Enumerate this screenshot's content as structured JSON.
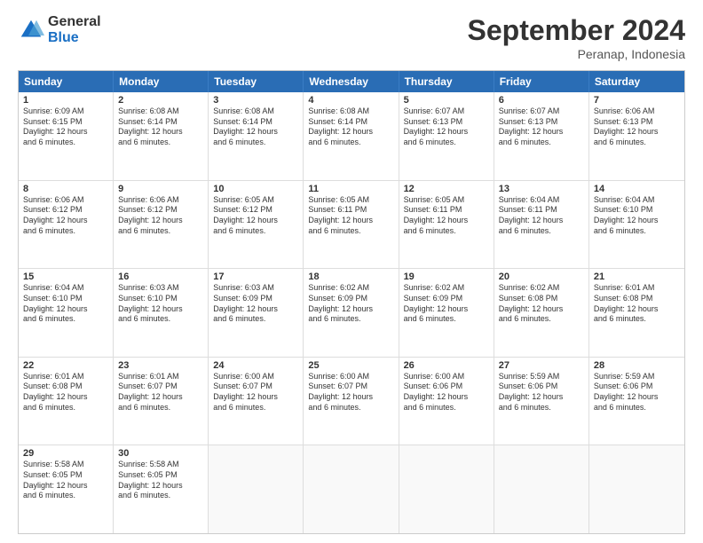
{
  "header": {
    "logo_general": "General",
    "logo_blue": "Blue",
    "title": "September 2024",
    "location": "Peranap, Indonesia"
  },
  "days": [
    "Sunday",
    "Monday",
    "Tuesday",
    "Wednesday",
    "Thursday",
    "Friday",
    "Saturday"
  ],
  "weeks": [
    [
      {
        "day": "1",
        "sunrise": "6:09 AM",
        "sunset": "6:15 PM",
        "daylight": "12 hours and 6 minutes."
      },
      {
        "day": "2",
        "sunrise": "6:08 AM",
        "sunset": "6:14 PM",
        "daylight": "12 hours and 6 minutes."
      },
      {
        "day": "3",
        "sunrise": "6:08 AM",
        "sunset": "6:14 PM",
        "daylight": "12 hours and 6 minutes."
      },
      {
        "day": "4",
        "sunrise": "6:08 AM",
        "sunset": "6:14 PM",
        "daylight": "12 hours and 6 minutes."
      },
      {
        "day": "5",
        "sunrise": "6:07 AM",
        "sunset": "6:13 PM",
        "daylight": "12 hours and 6 minutes."
      },
      {
        "day": "6",
        "sunrise": "6:07 AM",
        "sunset": "6:13 PM",
        "daylight": "12 hours and 6 minutes."
      },
      {
        "day": "7",
        "sunrise": "6:06 AM",
        "sunset": "6:13 PM",
        "daylight": "12 hours and 6 minutes."
      }
    ],
    [
      {
        "day": "8",
        "sunrise": "6:06 AM",
        "sunset": "6:12 PM",
        "daylight": "12 hours and 6 minutes."
      },
      {
        "day": "9",
        "sunrise": "6:06 AM",
        "sunset": "6:12 PM",
        "daylight": "12 hours and 6 minutes."
      },
      {
        "day": "10",
        "sunrise": "6:05 AM",
        "sunset": "6:12 PM",
        "daylight": "12 hours and 6 minutes."
      },
      {
        "day": "11",
        "sunrise": "6:05 AM",
        "sunset": "6:11 PM",
        "daylight": "12 hours and 6 minutes."
      },
      {
        "day": "12",
        "sunrise": "6:05 AM",
        "sunset": "6:11 PM",
        "daylight": "12 hours and 6 minutes."
      },
      {
        "day": "13",
        "sunrise": "6:04 AM",
        "sunset": "6:11 PM",
        "daylight": "12 hours and 6 minutes."
      },
      {
        "day": "14",
        "sunrise": "6:04 AM",
        "sunset": "6:10 PM",
        "daylight": "12 hours and 6 minutes."
      }
    ],
    [
      {
        "day": "15",
        "sunrise": "6:04 AM",
        "sunset": "6:10 PM",
        "daylight": "12 hours and 6 minutes."
      },
      {
        "day": "16",
        "sunrise": "6:03 AM",
        "sunset": "6:10 PM",
        "daylight": "12 hours and 6 minutes."
      },
      {
        "day": "17",
        "sunrise": "6:03 AM",
        "sunset": "6:09 PM",
        "daylight": "12 hours and 6 minutes."
      },
      {
        "day": "18",
        "sunrise": "6:02 AM",
        "sunset": "6:09 PM",
        "daylight": "12 hours and 6 minutes."
      },
      {
        "day": "19",
        "sunrise": "6:02 AM",
        "sunset": "6:09 PM",
        "daylight": "12 hours and 6 minutes."
      },
      {
        "day": "20",
        "sunrise": "6:02 AM",
        "sunset": "6:08 PM",
        "daylight": "12 hours and 6 minutes."
      },
      {
        "day": "21",
        "sunrise": "6:01 AM",
        "sunset": "6:08 PM",
        "daylight": "12 hours and 6 minutes."
      }
    ],
    [
      {
        "day": "22",
        "sunrise": "6:01 AM",
        "sunset": "6:08 PM",
        "daylight": "12 hours and 6 minutes."
      },
      {
        "day": "23",
        "sunrise": "6:01 AM",
        "sunset": "6:07 PM",
        "daylight": "12 hours and 6 minutes."
      },
      {
        "day": "24",
        "sunrise": "6:00 AM",
        "sunset": "6:07 PM",
        "daylight": "12 hours and 6 minutes."
      },
      {
        "day": "25",
        "sunrise": "6:00 AM",
        "sunset": "6:07 PM",
        "daylight": "12 hours and 6 minutes."
      },
      {
        "day": "26",
        "sunrise": "6:00 AM",
        "sunset": "6:06 PM",
        "daylight": "12 hours and 6 minutes."
      },
      {
        "day": "27",
        "sunrise": "5:59 AM",
        "sunset": "6:06 PM",
        "daylight": "12 hours and 6 minutes."
      },
      {
        "day": "28",
        "sunrise": "5:59 AM",
        "sunset": "6:06 PM",
        "daylight": "12 hours and 6 minutes."
      }
    ],
    [
      {
        "day": "29",
        "sunrise": "5:58 AM",
        "sunset": "6:05 PM",
        "daylight": "12 hours and 6 minutes."
      },
      {
        "day": "30",
        "sunrise": "5:58 AM",
        "sunset": "6:05 PM",
        "daylight": "12 hours and 6 minutes."
      },
      null,
      null,
      null,
      null,
      null
    ]
  ],
  "labels": {
    "sunrise": "Sunrise:",
    "sunset": "Sunset:",
    "daylight": "Daylight:"
  }
}
